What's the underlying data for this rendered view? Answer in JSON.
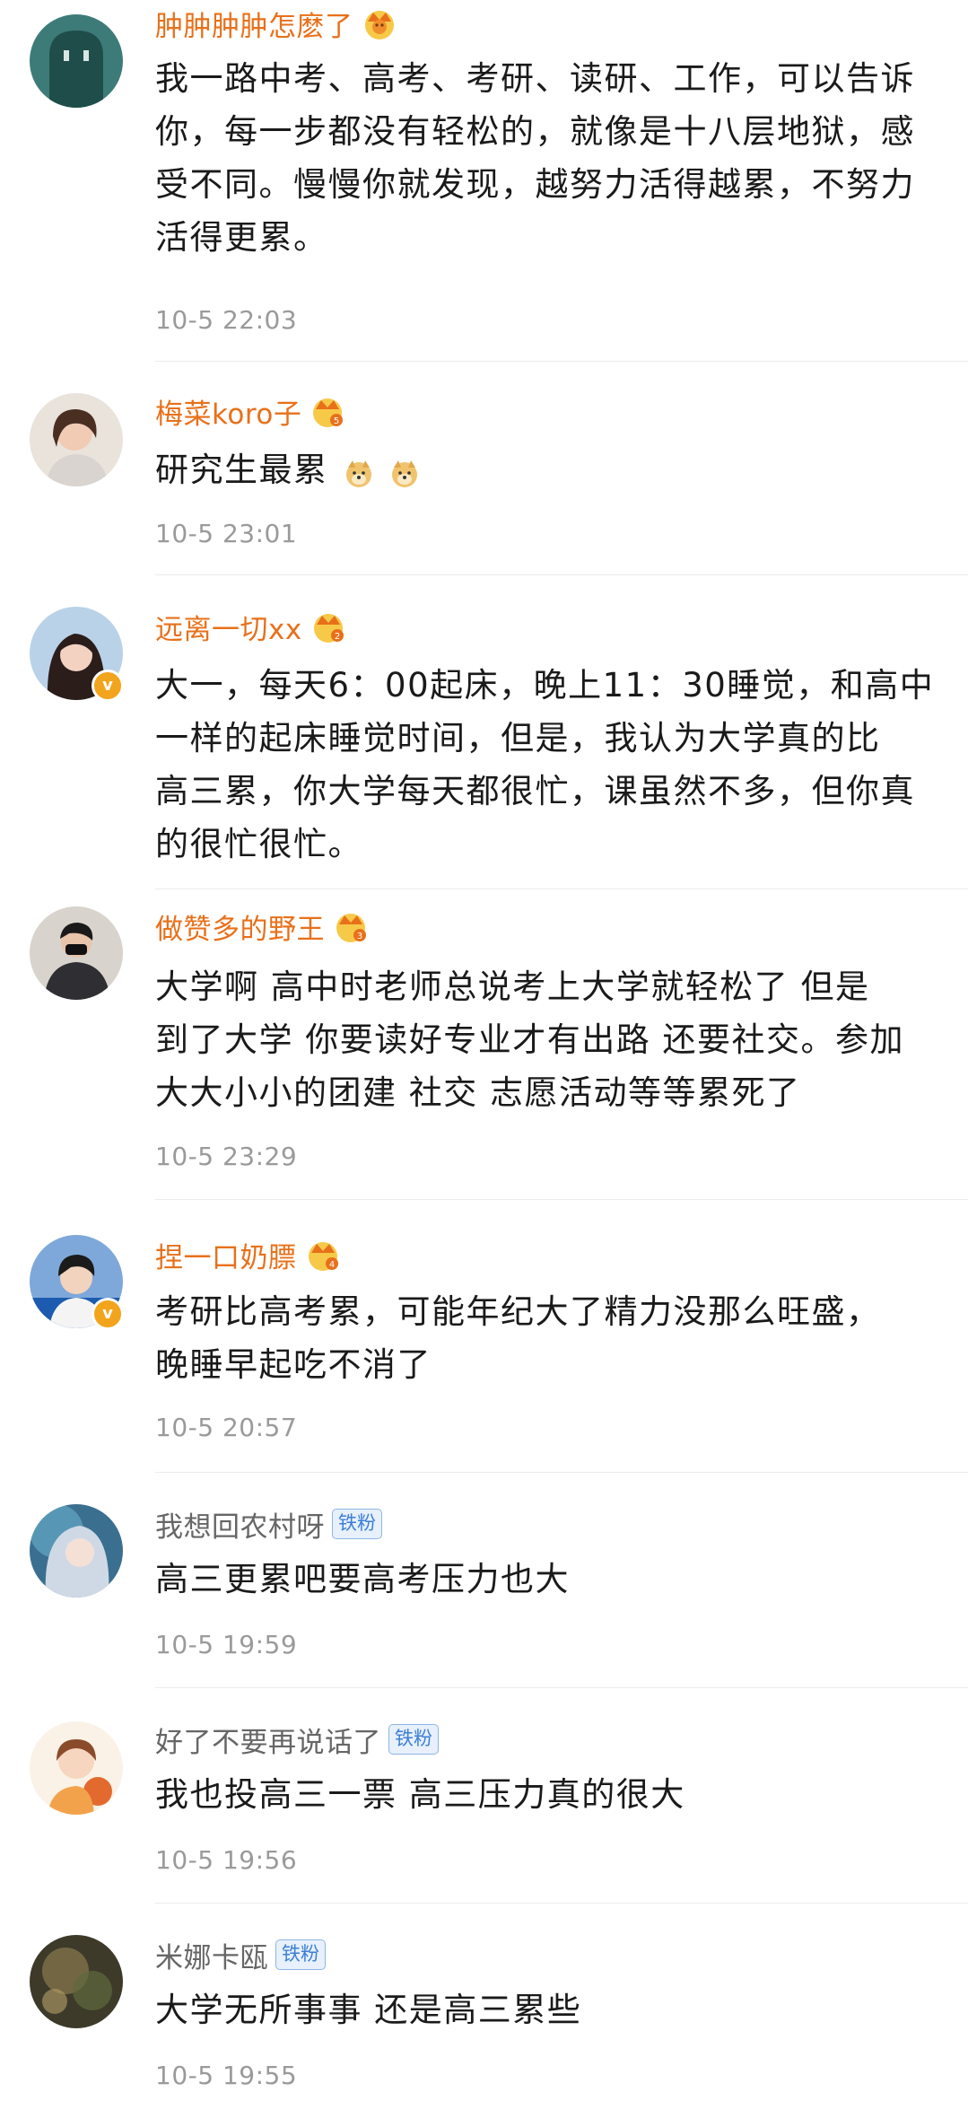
{
  "comments": [
    {
      "username": "肿肿肿肿怎麽了",
      "text_lines": [
        "我一路中考、高考、考研、读研、工作，可以告诉",
        "你，每一步都没有轻松的，就像是十八层地狱，感",
        "受不同。慢慢你就发现，越努力活得越累，不努力",
        "活得更累。"
      ],
      "time": "10-5 22:03",
      "badge_type": "crown",
      "crown_level": ""
    },
    {
      "username": "梅菜koro子",
      "text_lines": [
        "研究生最累"
      ],
      "time": "10-5 23:01",
      "badge_type": "crown",
      "crown_level": "5",
      "emojis": [
        "doge-emoji",
        "doge-emoji"
      ]
    },
    {
      "username": "远离一切xx",
      "text_lines": [
        "大一，每天6：00起床，晚上11：30睡觉，和高中",
        "一样的起床睡觉时间，但是，我认为大学真的比",
        "高三累，你大学每天都很忙，课虽然不多，但你真",
        "的很忙很忙。"
      ],
      "time": "",
      "badge_type": "crown",
      "crown_level": "2"
    },
    {
      "username": "做赞多的野王",
      "text_lines": [
        "大学啊 高中时老师总说考上大学就轻松了 但是",
        "到了大学 你要读好专业才有出路 还要社交。参加",
        "大大小小的团建 社交 志愿活动等等累死了"
      ],
      "time": "10-5 23:29",
      "badge_type": "crown",
      "crown_level": "3"
    },
    {
      "username": "捏一口奶膘",
      "text_lines": [
        "考研比高考累，可能年纪大了精力没那么旺盛，",
        "晚睡早起吃不消了"
      ],
      "time": "10-5 20:57",
      "badge_type": "crown",
      "crown_level": "4"
    },
    {
      "username": "我想回农村呀",
      "text_lines": [
        "高三更累吧要高考压力也大"
      ],
      "time": "10-5 19:59",
      "badge_type": "fan",
      "fan_label": "铁粉"
    },
    {
      "username": "好了不要再说话了",
      "text_lines": [
        "我也投高三一票 高三压力真的很大"
      ],
      "time": "10-5 19:56",
      "badge_type": "fan",
      "fan_label": "铁粉"
    },
    {
      "username": "米娜卡瓯",
      "text_lines": [
        "大学无所事事 还是高三累些"
      ],
      "time": "10-5 19:55",
      "badge_type": "fan",
      "fan_label": "铁粉"
    }
  ],
  "colors": {
    "vip_name": "#e8701a",
    "plain_name": "#666666",
    "time": "#9a9a9a",
    "fan_badge": "#3d7fd6",
    "verified": "#f2a41c"
  }
}
